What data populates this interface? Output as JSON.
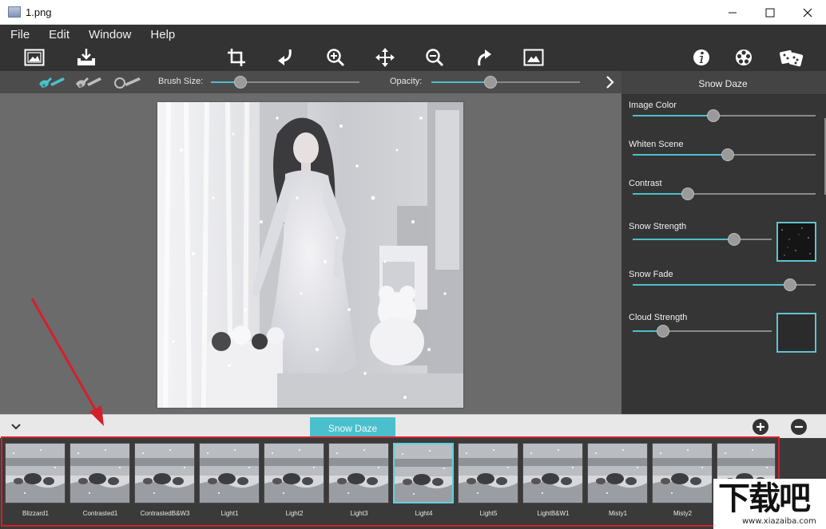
{
  "window": {
    "title": "1.png"
  },
  "menu": [
    "File",
    "Edit",
    "Window",
    "Help"
  ],
  "toolbar": {
    "left": [
      "open-image-icon",
      "save-export-icon"
    ],
    "center": [
      "crop-icon",
      "undo-icon",
      "zoom-in-icon",
      "move-icon",
      "zoom-out-icon",
      "redo-icon",
      "fit-image-icon"
    ],
    "right": [
      "info-icon",
      "settings-icon",
      "random-dice-icon"
    ]
  },
  "brush_bar": {
    "brush_size_label": "Brush Size:",
    "brush_size": 0.2,
    "opacity_label": "Opacity:",
    "opacity": 0.4
  },
  "panel": {
    "title": "Snow Daze",
    "sliders": [
      {
        "label": "Image Color",
        "value": 0.44
      },
      {
        "label": "Whiten Scene",
        "value": 0.52
      },
      {
        "label": "Contrast",
        "value": 0.3
      },
      {
        "label": "Snow Strength",
        "value": 0.73
      },
      {
        "label": "Snow Fade",
        "value": 0.86
      },
      {
        "label": "Cloud Strength",
        "value": 0.22
      }
    ]
  },
  "film_bar": {
    "active_tab": "Snow Daze"
  },
  "presets": [
    "Blizzard1",
    "Contrasted1",
    "ContrastedB&W3",
    "Light1",
    "Light2",
    "Light3",
    "Light4",
    "Light5",
    "LightB&W1",
    "Misty1",
    "Misty2",
    ""
  ],
  "selected_preset": "Light4",
  "watermark": {
    "big": "下载吧",
    "url": "www.xiazaiba.com"
  },
  "colors": {
    "accent": "#4bc0cd",
    "dark": "#333333",
    "panel": "#353535",
    "highlight_red": "#d4202a"
  }
}
